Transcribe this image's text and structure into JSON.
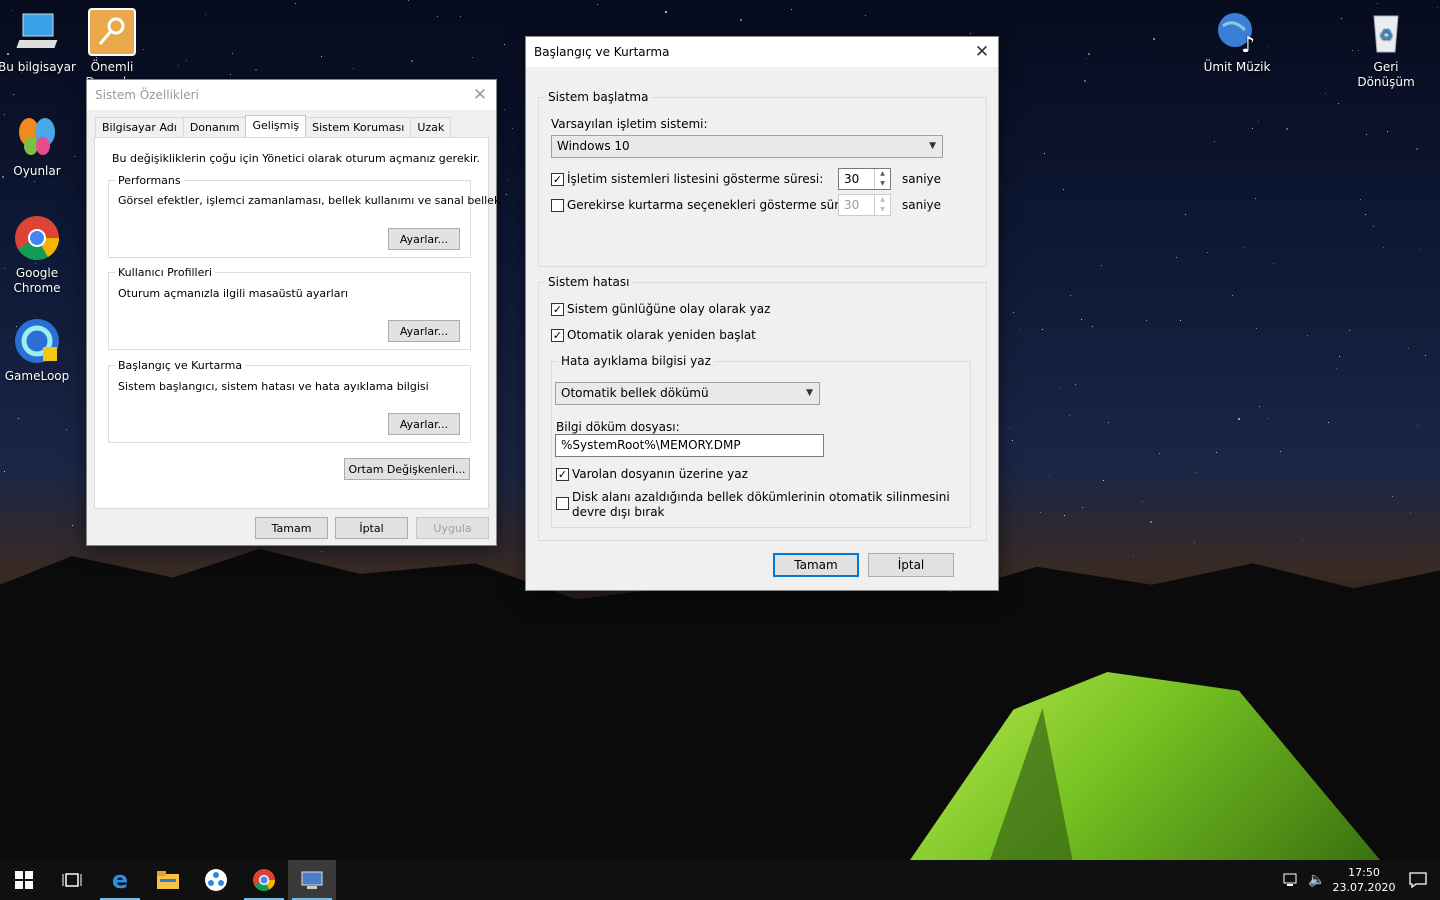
{
  "desktop_icons": [
    {
      "label": "Bu bilgisayar",
      "icon": "computer-icon"
    },
    {
      "label": "Önemli Dosyalar",
      "icon": "key-folder-icon"
    },
    {
      "label": "Oyunlar",
      "icon": "msn-butterfly-icon"
    },
    {
      "label": "Google Chrome",
      "icon": "chrome-icon"
    },
    {
      "label": "GameLoop",
      "icon": "gameloop-icon"
    },
    {
      "label": "Ümit Müzik",
      "icon": "music-globe-icon"
    },
    {
      "label": "Geri Dönüşüm Kutusu",
      "icon": "recycle-bin-icon"
    }
  ],
  "system_properties": {
    "title": "Sistem Özellikleri",
    "tabs": [
      "Bilgisayar Adı",
      "Donanım",
      "Gelişmiş",
      "Sistem Koruması",
      "Uzak"
    ],
    "active_tab": "Gelişmiş",
    "admin_note": "Bu değişikliklerin çoğu için Yönetici olarak oturum açmanız gerekir.",
    "groups": [
      {
        "title": "Performans",
        "desc": "Görsel efektler, işlemci zamanlaması, bellek kullanımı ve sanal bellek",
        "button": "Ayarlar..."
      },
      {
        "title": "Kullanıcı Profilleri",
        "desc": "Oturum açmanızla ilgili masaüstü ayarları",
        "button": "Ayarlar..."
      },
      {
        "title": "Başlangıç ve Kurtarma",
        "desc": "Sistem başlangıcı, sistem hatası ve hata ayıklama bilgisi",
        "button": "Ayarlar..."
      }
    ],
    "env_button": "Ortam Değişkenleri...",
    "ok": "Tamam",
    "cancel": "İptal",
    "apply": "Uygula"
  },
  "startup_recovery": {
    "title": "Başlangıç ve Kurtarma",
    "startup_group": "Sistem başlatma",
    "default_os_label": "Varsayılan işletim sistemi:",
    "default_os_value": "Windows 10",
    "show_os_list_label": "İşletim sistemleri listesini gösterme süresi:",
    "show_os_list_checked": true,
    "show_os_list_value": "30",
    "show_recovery_label": "Gerekirse kurtarma seçenekleri gösterme süresi:",
    "show_recovery_checked": false,
    "show_recovery_value": "30",
    "seconds_label": "saniye",
    "failure_group": "Sistem hatası",
    "write_event_label": "Sistem günlüğüne olay olarak yaz",
    "write_event_checked": true,
    "auto_restart_label": "Otomatik olarak yeniden başlat",
    "auto_restart_checked": true,
    "debug_group": "Hata ayıklama bilgisi yaz",
    "debug_type_value": "Otomatik bellek dökümü",
    "dump_file_label": "Bilgi döküm dosyası:",
    "dump_file_value": "%SystemRoot%\\MEMORY.DMP",
    "overwrite_label": "Varolan dosyanın üzerine yaz",
    "overwrite_checked": true,
    "disable_autodelete_label": "Disk alanı azaldığında bellek dökümlerinin otomatik silinmesini devre dışı bırak",
    "disable_autodelete_checked": false,
    "ok": "Tamam",
    "cancel": "İptal"
  },
  "taskbar": {
    "apps": [
      "start-icon",
      "task-view-icon",
      "edge-icon",
      "file-explorer-icon",
      "app-icon",
      "chrome-icon",
      "system-properties-icon"
    ],
    "time": "17:50",
    "date": "23.07.2020"
  }
}
